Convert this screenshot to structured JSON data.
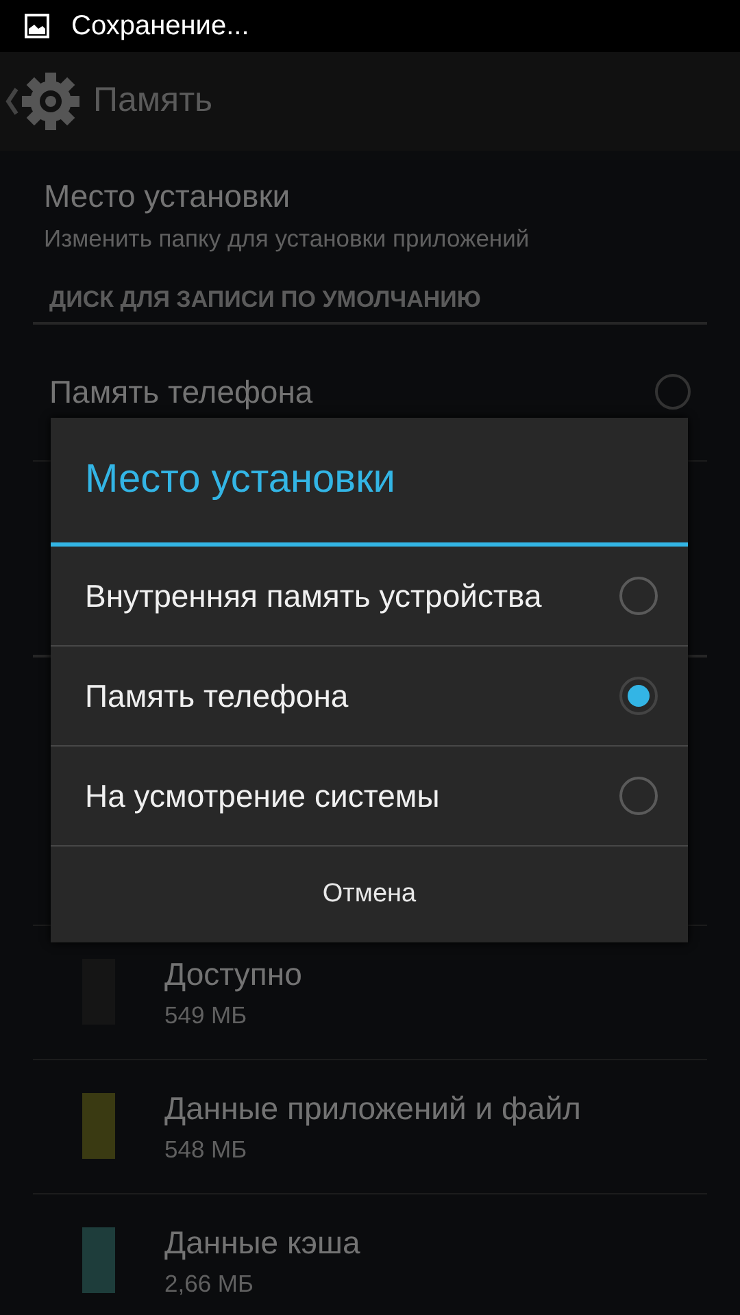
{
  "status_bar": {
    "notification": "Сохранение..."
  },
  "action_bar": {
    "title": "Память"
  },
  "install_location": {
    "title": "Место установки",
    "subtitle": "Изменить папку для установки приложений"
  },
  "section_header": "ДИСК ДЛЯ ЗАПИСИ ПО УМОЛЧАНИЮ",
  "default_disk_options": [
    {
      "label": "Память телефона",
      "selected": false
    }
  ],
  "storage_items": [
    {
      "label": "Доступно",
      "size": "549 МБ",
      "color": "#151515"
    },
    {
      "label": "Данные приложений и файл",
      "size": "548 МБ",
      "color": "#3a3a12"
    },
    {
      "label": "Данные кэша",
      "size": "2,66 МБ",
      "color": "#1e3d3b"
    }
  ],
  "dialog": {
    "title": "Место установки",
    "options": [
      {
        "label": "Внутренняя память устройства",
        "selected": false
      },
      {
        "label": "Память телефона",
        "selected": true
      },
      {
        "label": "На усмотрение системы",
        "selected": false
      }
    ],
    "cancel": "Отмена"
  }
}
